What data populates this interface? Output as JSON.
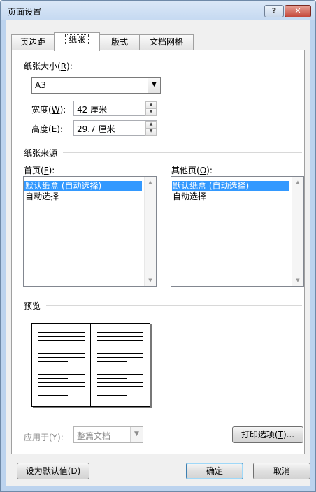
{
  "window": {
    "title": "页面设置",
    "help_label": "?",
    "close_label": "✕"
  },
  "tabs": [
    {
      "label": "页边距",
      "active": false
    },
    {
      "label": "纸张",
      "active": true
    },
    {
      "label": "版式",
      "active": false
    },
    {
      "label": "文档网格",
      "active": false
    }
  ],
  "paper_size": {
    "group_prefix": "纸张大小(",
    "group_key": "R",
    "group_suffix": "):",
    "selected": "A3",
    "width_prefix": "宽度(",
    "width_key": "W",
    "width_suffix": "):",
    "width_value": "42 厘米",
    "height_prefix": "高度(",
    "height_key": "E",
    "height_suffix": "):",
    "height_value": "29.7 厘米"
  },
  "paper_source": {
    "group_label": "纸张来源",
    "first_page_prefix": "首页(",
    "first_page_key": "F",
    "first_page_suffix": "):",
    "other_pages_prefix": "其他页(",
    "other_pages_key": "O",
    "other_pages_suffix": "):",
    "first_page_items": [
      {
        "label": "默认纸盒 (自动选择)",
        "selected": true
      },
      {
        "label": "自动选择",
        "selected": false
      }
    ],
    "other_pages_items": [
      {
        "label": "默认纸盒 (自动选择)",
        "selected": true
      },
      {
        "label": "自动选择",
        "selected": false
      }
    ]
  },
  "preview": {
    "group_label": "预览"
  },
  "apply_to": {
    "label": "应用于(Y):",
    "value": "整篇文档",
    "enabled": false
  },
  "buttons": {
    "print_options_prefix": "打印选项(",
    "print_options_key": "T",
    "print_options_suffix": ")...",
    "set_default_prefix": "设为默认值(",
    "set_default_key": "D",
    "set_default_suffix": ")",
    "ok": "确定",
    "cancel": "取消"
  },
  "colors": {
    "selection": "#3399ff",
    "title_bar": "#c5d9f1",
    "close_button": "#c4473a"
  }
}
